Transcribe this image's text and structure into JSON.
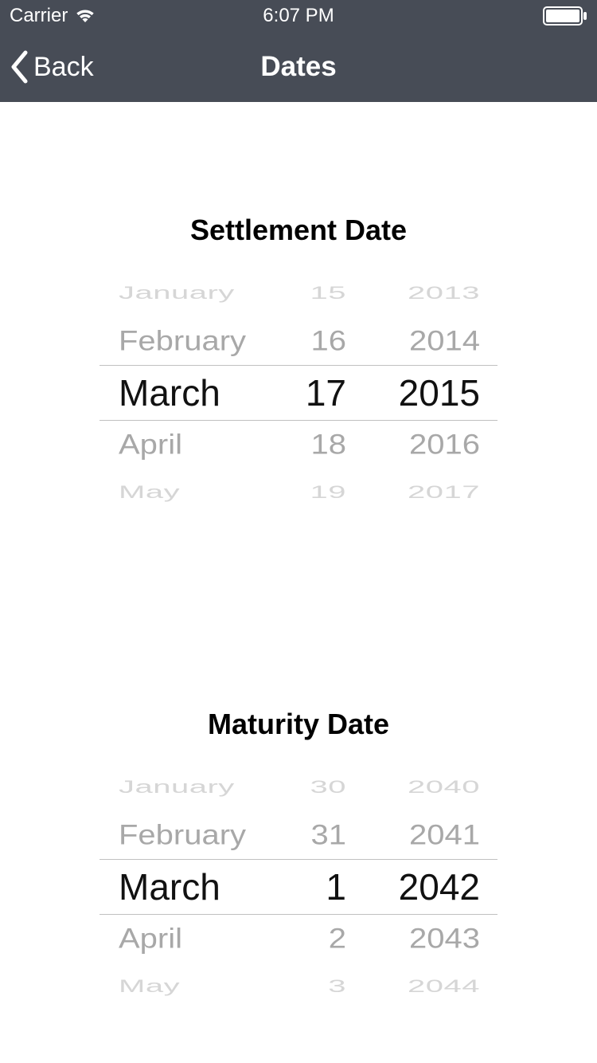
{
  "status_bar": {
    "carrier": "Carrier",
    "time": "6:07 PM"
  },
  "nav": {
    "back_label": "Back",
    "title": "Dates"
  },
  "settlement": {
    "title": "Settlement Date",
    "rows": {
      "far_above": {
        "month": "January",
        "day": "15",
        "year": "2013"
      },
      "above": {
        "month": "February",
        "day": "16",
        "year": "2014"
      },
      "selected": {
        "month": "March",
        "day": "17",
        "year": "2015"
      },
      "below": {
        "month": "April",
        "day": "18",
        "year": "2016"
      },
      "far_below": {
        "month": "May",
        "day": "19",
        "year": "2017"
      }
    }
  },
  "maturity": {
    "title": "Maturity Date",
    "rows": {
      "far_above": {
        "month": "January",
        "day": "30",
        "year": "2040"
      },
      "above": {
        "month": "February",
        "day": "31",
        "year": "2041"
      },
      "selected": {
        "month": "March",
        "day": "1",
        "year": "2042"
      },
      "below": {
        "month": "April",
        "day": "2",
        "year": "2043"
      },
      "far_below": {
        "month": "May",
        "day": "3",
        "year": "2044"
      }
    }
  }
}
